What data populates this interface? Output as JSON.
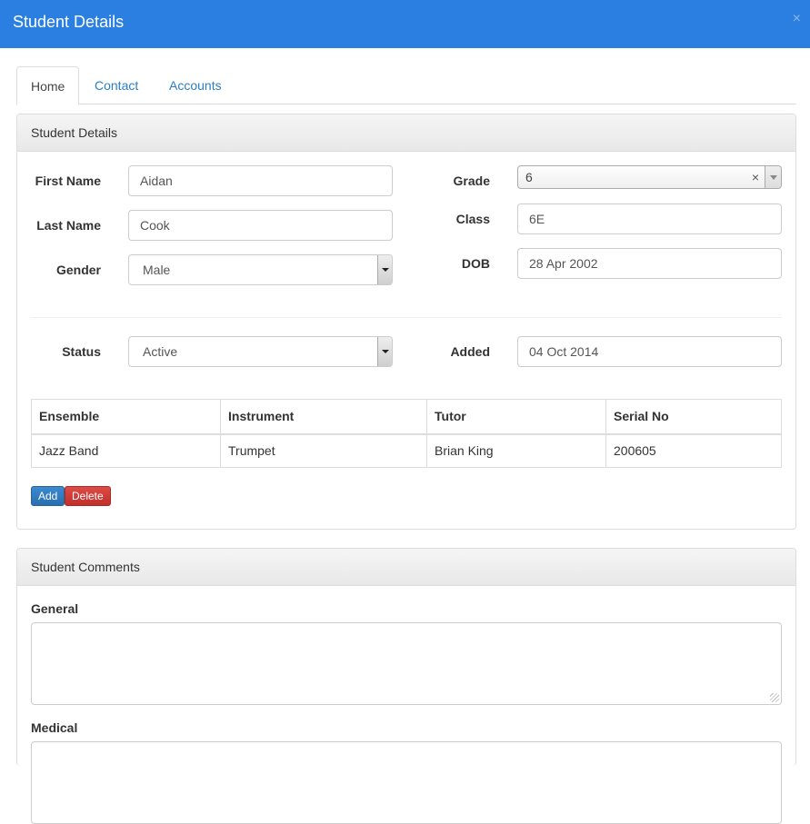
{
  "window": {
    "title": "Student Details",
    "close_glyph": "×"
  },
  "tabs": [
    {
      "label": "Home",
      "active": true
    },
    {
      "label": "Contact",
      "active": false
    },
    {
      "label": "Accounts",
      "active": false
    }
  ],
  "details": {
    "heading": "Student Details",
    "first_name_label": "First Name",
    "first_name": "Aidan",
    "last_name_label": "Last Name",
    "last_name": "Cook",
    "gender_label": "Gender",
    "gender": "Male",
    "grade_label": "Grade",
    "grade": "6",
    "grade_clear": "×",
    "class_label": "Class",
    "class": "6E",
    "dob_label": "DOB",
    "dob": "28 Apr 2002",
    "status_label": "Status",
    "status": "Active",
    "added_label": "Added",
    "added": "04 Oct 2014"
  },
  "ensembles": {
    "columns": [
      "Ensemble",
      "Instrument",
      "Tutor",
      "Serial No"
    ],
    "rows": [
      [
        "Jazz Band",
        "Trumpet",
        "Brian King",
        "200605"
      ]
    ],
    "add_label": "Add",
    "delete_label": "Delete"
  },
  "comments": {
    "heading": "Student Comments",
    "general_label": "General",
    "general_value": "",
    "medical_label": "Medical",
    "medical_value": ""
  },
  "colors": {
    "header_bg": "#2a7fe0",
    "link": "#2a7fc7",
    "add_button": "#3c8ad0",
    "delete_button": "#d9534f"
  }
}
